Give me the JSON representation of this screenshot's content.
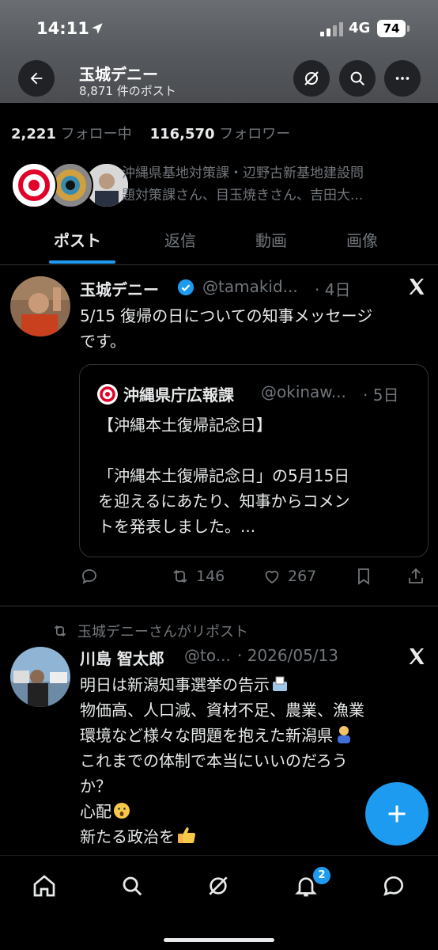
{
  "status_bar": {
    "time": "14:11",
    "network": "4G",
    "battery": "74"
  },
  "header": {
    "title": "玉城デニー",
    "subtitle": "8,871 件のポスト"
  },
  "profile": {
    "following_count": "2,221",
    "following_label": "フォロー中",
    "followers_count": "116,570",
    "followers_label": "フォロワー",
    "followed_by_line1": "沖縄県基地対策課・辺野古新基地建設問",
    "followed_by_line2": "題対策課さん、目玉焼きさん、吉田大..."
  },
  "tabs": [
    "ポスト",
    "返信",
    "動画",
    "画像"
  ],
  "posts": [
    {
      "author": "玉城デニー",
      "handle": "@tamakid...",
      "time": "· 4日",
      "text_line1": "5/15 復帰の日についての知事メッセージ",
      "text_line2": "です。",
      "quote": {
        "author": "沖縄県庁広報課",
        "handle": "@okinaw...",
        "time": "· 5日",
        "line1": "【沖縄本土復帰記念日】",
        "line2": "「沖縄本土復帰記念日」の5月15日",
        "line3": "を迎えるにあたり、知事からコメン",
        "line4": "トを発表しました。..."
      },
      "retweets": "146",
      "likes": "267"
    },
    {
      "repost_label": "玉城デニーさんがリポスト",
      "author": "川島 智太郎",
      "handle": "@to...",
      "time": "· 2026/05/13",
      "line1": "明日は新潟知事選挙の告示",
      "line2": "物価高、人口減、資材不足、農業、漁業",
      "line3": "環境など様々な問題を抱えた新潟県",
      "line4": "これまでの体制で本当にいいのだろう",
      "line5": "か？",
      "line6": "心配",
      "line7": "新たる政治を"
    }
  ],
  "nav": {
    "notifications_badge": "2"
  },
  "icons": [
    "back-arrow-icon",
    "grok-icon",
    "search-icon",
    "more-icon",
    "verified-icon",
    "x-logo-icon",
    "reply-icon",
    "retweet-icon",
    "like-icon",
    "bookmark-icon",
    "share-icon",
    "repost-icon",
    "compose-plus-icon",
    "home-icon",
    "notifications-icon",
    "messages-icon"
  ],
  "colors": {
    "accent": "#1d9bf0",
    "muted": "#71767b",
    "text": "#e7e9ea",
    "background": "#000000"
  }
}
